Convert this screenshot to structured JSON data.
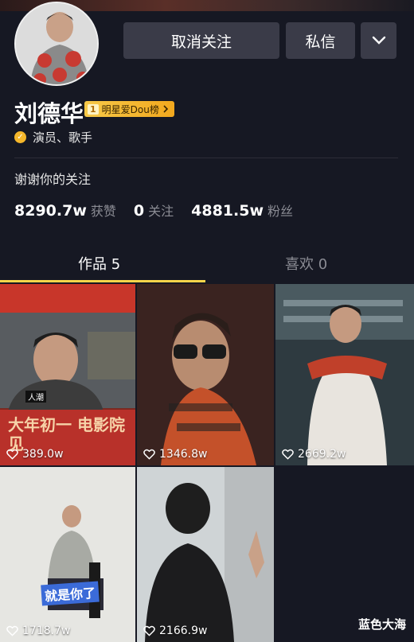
{
  "profile": {
    "name": "刘德华",
    "rank_num": "1",
    "rank_label": "明星爱Dou榜",
    "verification": "演员、歌手",
    "bio": "谢谢你的关注"
  },
  "actions": {
    "unfollow_label": "取消关注",
    "message_label": "私信"
  },
  "stats": [
    {
      "value": "8290.7w",
      "label": "获赞"
    },
    {
      "value": "0",
      "label": "关注"
    },
    {
      "value": "4881.5w",
      "label": "粉丝"
    }
  ],
  "tabs": [
    {
      "label": "作品 5"
    },
    {
      "label": "喜欢 0"
    }
  ],
  "videos": [
    {
      "likes": "389.0w",
      "overlay_text": "大年初一 电影院见",
      "overlay_small": "人潮"
    },
    {
      "likes": "1346.8w"
    },
    {
      "likes": "2669.2w"
    },
    {
      "likes": "1718.7w",
      "overlay_text": "就是你了"
    },
    {
      "likes": "2166.9w"
    }
  ],
  "watermark": "蓝色大海",
  "colors": {
    "background": "#161823",
    "button": "#3a3b48",
    "tab_indicator": "#f8d54a",
    "rank_badge": "#f2a81e"
  }
}
